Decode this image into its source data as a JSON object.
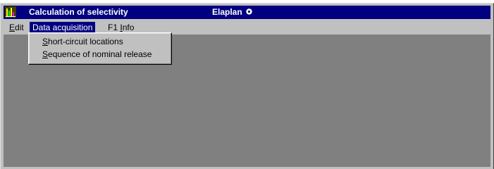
{
  "titlebar": {
    "title": "Calculation of selectivity",
    "product": "Elaplan",
    "app_icon": "chart-bars-icon",
    "product_glyph": "registered-circle-icon",
    "background_color": "#000080",
    "text_color": "#ffffff"
  },
  "menubar": {
    "items": [
      {
        "key": "E",
        "rest": "dit"
      },
      {
        "text": "Data acquisition",
        "active": true
      },
      {
        "pre": "F1 ",
        "key": "I",
        "rest": "nfo"
      }
    ],
    "active_color": "#000080"
  },
  "dropdown": {
    "items": [
      {
        "key": "S",
        "rest": "hort-circuit locations"
      },
      {
        "key": "S",
        "rest": "equence of nominal release"
      }
    ]
  },
  "client_area": {
    "background_color": "#808080"
  }
}
